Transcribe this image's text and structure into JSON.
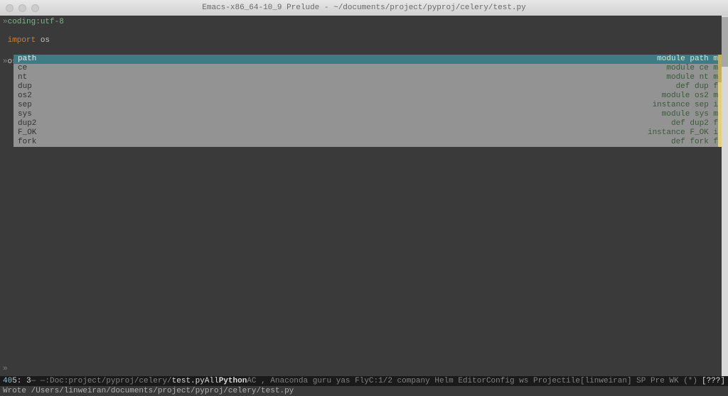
{
  "window": {
    "title": "Emacs-x86_64-10_9 Prelude - ~/documents/project/pyproj/celery/test.py"
  },
  "code": {
    "coding_directive": "coding:utf-8",
    "import_kw": "import",
    "import_module": "os",
    "current_prefix": "os."
  },
  "completions": [
    {
      "label": "path",
      "meta": "module path m",
      "selected": true
    },
    {
      "label": "ce",
      "meta": "module ce m",
      "selected": false
    },
    {
      "label": "nt",
      "meta": "module nt m",
      "selected": false
    },
    {
      "label": "dup",
      "meta": "def dup f",
      "selected": false
    },
    {
      "label": "os2",
      "meta": "module os2 m",
      "selected": false
    },
    {
      "label": "sep",
      "meta": "instance sep i",
      "selected": false
    },
    {
      "label": "sys",
      "meta": "module sys m",
      "selected": false
    },
    {
      "label": "dup2",
      "meta": "def dup2 f",
      "selected": false
    },
    {
      "label": "F_OK",
      "meta": "instance F_OK i",
      "selected": false
    },
    {
      "label": "fork",
      "meta": "def fork f",
      "selected": false
    }
  ],
  "modeline": {
    "col": "40",
    "pos": "5: 3",
    "dash": "— —:",
    "doc": "Doc:",
    "path_dim": "project/pyproj/celery/",
    "path_bright": "test.py",
    "all": "All",
    "python": "Python",
    "minor": "AC , Anaconda guru yas FlyC:1/2 company Helm EditorConfig ws Projectile[linweiran] SP Pre WK (*)",
    "right": "[???]"
  },
  "minibuffer": {
    "message": "Wrote /Users/linweiran/documents/project/pyproj/celery/test.py"
  }
}
